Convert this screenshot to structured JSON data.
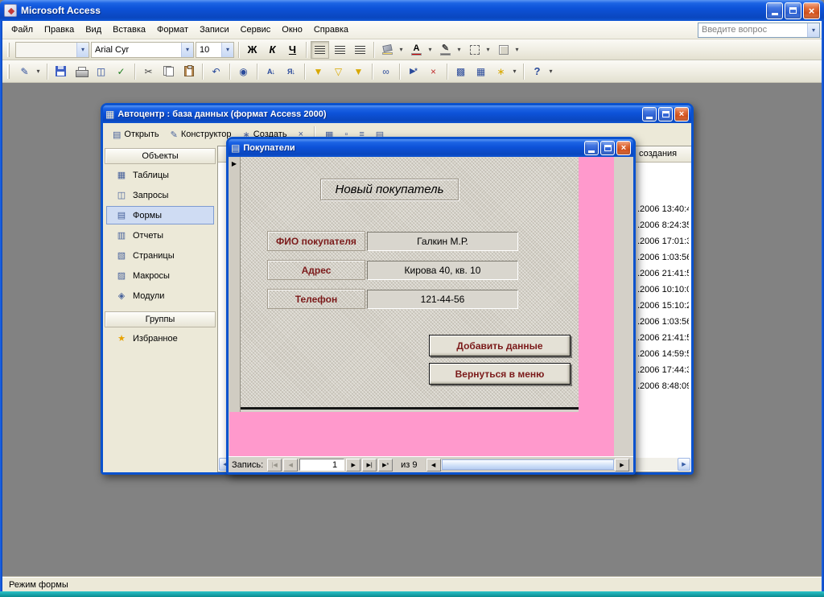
{
  "colors": {
    "pink": "#FF99CC",
    "label_red": "#7B1A1A",
    "font_color_bar": "#CC0000",
    "fill_color_bar": "#FFE066",
    "line_color_bar": "#6B6B6B"
  },
  "app": {
    "title": "Microsoft Access"
  },
  "menu": {
    "items": [
      "Файл",
      "Правка",
      "Вид",
      "Вставка",
      "Формат",
      "Записи",
      "Сервис",
      "Окно",
      "Справка"
    ],
    "ask_placeholder": "Введите вопрос"
  },
  "format_toolbar": {
    "object_value": "",
    "font_name": "Arial Cyr",
    "font_size": "10",
    "bold_label": "Ж",
    "italic_label": "К",
    "underline_label": "Ч",
    "font_color_letter": "А"
  },
  "icons": {
    "close": "×",
    "dropdown_arrow": "▾",
    "view_design": "✎",
    "print_preview": "◫",
    "spelling": "✓",
    "cut": "✂",
    "undo": "↶",
    "hyperlink": "◉",
    "sort_asc": "А↓",
    "sort_desc": "Я↓",
    "filter_selection": "▼",
    "filter_form": "▽",
    "apply_filter": "▼",
    "find": "∞",
    "new_record": "▶*",
    "delete_record": "×",
    "properties": "▩",
    "db_window": "▦",
    "new_object": "∗",
    "help": "?",
    "db_open": "▤",
    "db_design": "✎",
    "db_new": "∗",
    "db_delete": "×",
    "view_large": "▦",
    "view_small": "▫",
    "view_list": "≡",
    "view_details": "▤",
    "obj_tables": "▦",
    "obj_queries": "◫",
    "obj_forms": "▤",
    "obj_reports": "▥",
    "obj_pages": "▧",
    "obj_macros": "▨",
    "obj_modules": "◈",
    "favorites_star": "★",
    "record_selector": "▶",
    "nav_first": "|◀",
    "nav_prev": "◀",
    "nav_next": "▶",
    "nav_last": "▶|",
    "nav_new": "▶*",
    "scroll_left": "◀",
    "scroll_right": "▶"
  },
  "db_window": {
    "title": "Автоцентр : база данных (формат Access 2000)",
    "toolbar": {
      "open_label": "Открыть",
      "design_label": "Конструктор",
      "new_label": "Создать"
    },
    "objects_header": "Объекты",
    "groups_header": "Группы",
    "object_items": [
      "Таблицы",
      "Запросы",
      "Формы",
      "Отчеты",
      "Страницы",
      "Макросы",
      "Модули"
    ],
    "favorites_label": "Избранное",
    "list_column_header": "создания",
    "date_cells": [
      ".2006 13:40:4",
      ".2006 8:24:35",
      ".2006 17:01:3",
      ".2006 1:03:56",
      ".2006 21:41:5",
      ".2006 10:10:0",
      ".2006 15:10:2",
      ".2006 1:03:56",
      ".2006 21:41:5",
      ".2006 14:59:5",
      ".2006 17:44:3",
      ".2006 8:48:09"
    ]
  },
  "form_window": {
    "title": "Покупатели",
    "heading": "Новый покупатель",
    "rows": [
      {
        "label": "ФИО покупателя",
        "value": "Галкин М.Р."
      },
      {
        "label": "Адрес",
        "value": "Кирова 40, кв. 10"
      },
      {
        "label": "Телефон",
        "value": "121-44-56"
      }
    ],
    "buttons": {
      "add_label": "Добавить данные",
      "back_label": "Вернуться в меню"
    },
    "nav": {
      "label": "Запись:",
      "current": "1",
      "count_label": "из 9"
    }
  },
  "status_bar": {
    "text": "Режим формы"
  }
}
